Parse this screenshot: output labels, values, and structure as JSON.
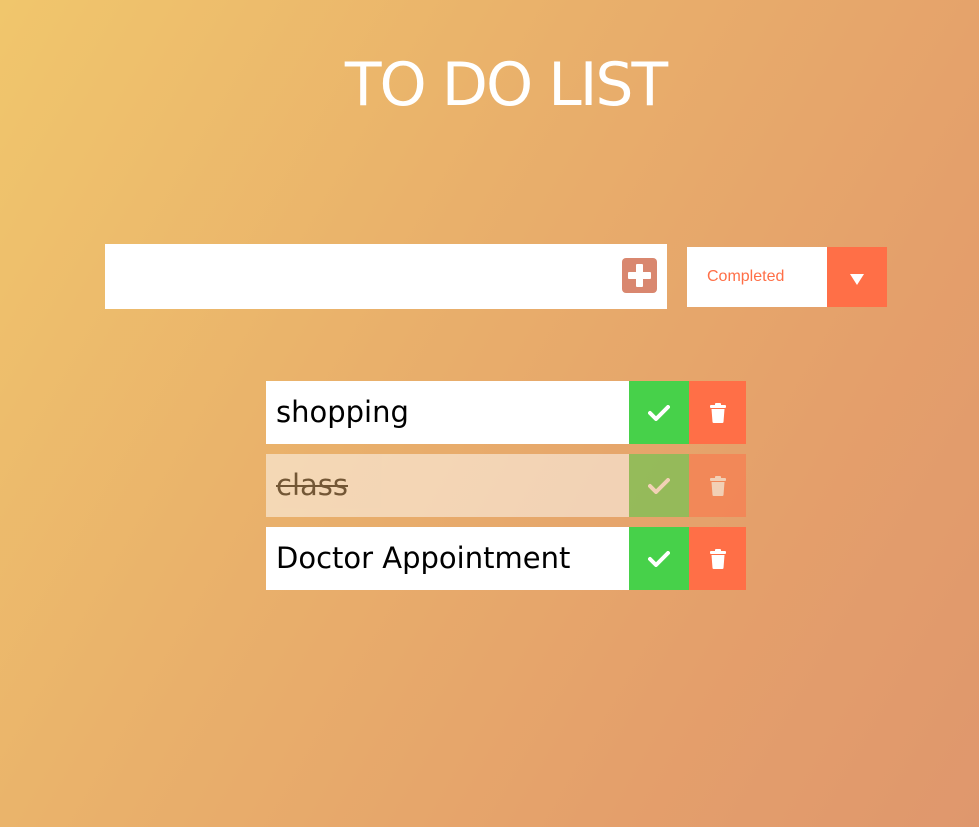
{
  "header": {
    "title": "TO DO LIST"
  },
  "new_todo": {
    "value": "",
    "placeholder": "",
    "add_icon": "plus-square-icon"
  },
  "filter": {
    "selected": "Completed",
    "arrow_icon": "caret-down-icon"
  },
  "todos": [
    {
      "text": "shopping",
      "completed": false
    },
    {
      "text": "class",
      "completed": true
    },
    {
      "text": "Doctor Appointment",
      "completed": false
    }
  ],
  "icons": {
    "complete": "check-icon",
    "delete": "trash-icon"
  },
  "colors": {
    "accent": "#ff6f47",
    "complete": "#47d14a",
    "add_button": "#d9876f",
    "title": "#ffffff"
  }
}
